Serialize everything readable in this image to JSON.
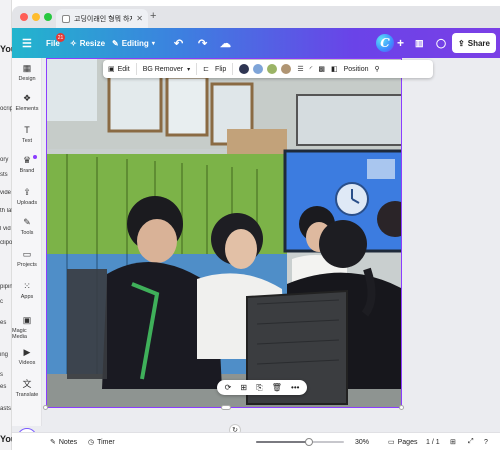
{
  "background_app": {
    "you_label": "You",
    "you_label_bottom": "You",
    "fragments": [
      "ocrip",
      "ory",
      "sts",
      "vide",
      "th lat",
      "l vid",
      "clipo",
      "piping",
      "c",
      "es",
      "ing",
      "s",
      "es",
      "asts"
    ]
  },
  "browser": {
    "tab_title": "고딩이래인 형뭐 하자여 ...",
    "tab_close": "✕",
    "new_tab": "+"
  },
  "toolbar": {
    "menu_icon": "☰",
    "file_label": "File",
    "file_badge": "21",
    "resize_label": "Resize",
    "editing_label": "Editing",
    "undo_icon": "↶",
    "redo_icon": "↷",
    "cloud_icon": "☁",
    "avatar_letter": "C",
    "add_icon": "+",
    "stats_icon": "📊",
    "comment_icon": "💬",
    "share_label": "Share"
  },
  "sidebar": {
    "items": [
      {
        "label": "Design",
        "icon": "▦"
      },
      {
        "label": "Elements",
        "icon": "❖"
      },
      {
        "label": "Text",
        "icon": "T"
      },
      {
        "label": "Brand",
        "icon": "♛"
      },
      {
        "label": "Uploads",
        "icon": "⇪"
      },
      {
        "label": "Tools",
        "icon": "✎"
      },
      {
        "label": "Projects",
        "icon": "▭"
      },
      {
        "label": "Apps",
        "icon": "⁙"
      },
      {
        "label": "Magic Media",
        "icon": "▣"
      },
      {
        "label": "Videos",
        "icon": "▶"
      },
      {
        "label": "Translate",
        "icon": "文"
      }
    ],
    "assistant_icon": "✦"
  },
  "context_toolbar": {
    "edit_label": "Edit",
    "bg_remover_label": "BG Remover",
    "flip_label": "Flip",
    "position_label": "Position",
    "swatches": [
      "#2e3552",
      "#7ea4d8",
      "#9bb466",
      "#b09573"
    ]
  },
  "float_actions": {
    "icons": [
      "⟳",
      "⊞",
      "⎘",
      "🗑",
      "•••"
    ]
  },
  "bottom_bar": {
    "notes_label": "Notes",
    "timer_label": "Timer",
    "zoom_value": "30%",
    "zoom_fraction": 0.6,
    "pages_label": "Pages",
    "page_indicator": "1 / 1"
  },
  "colors": {
    "accent": "#8b3dff",
    "toolbar_start": "#22b5cd",
    "toolbar_end": "#7b3fe6"
  }
}
